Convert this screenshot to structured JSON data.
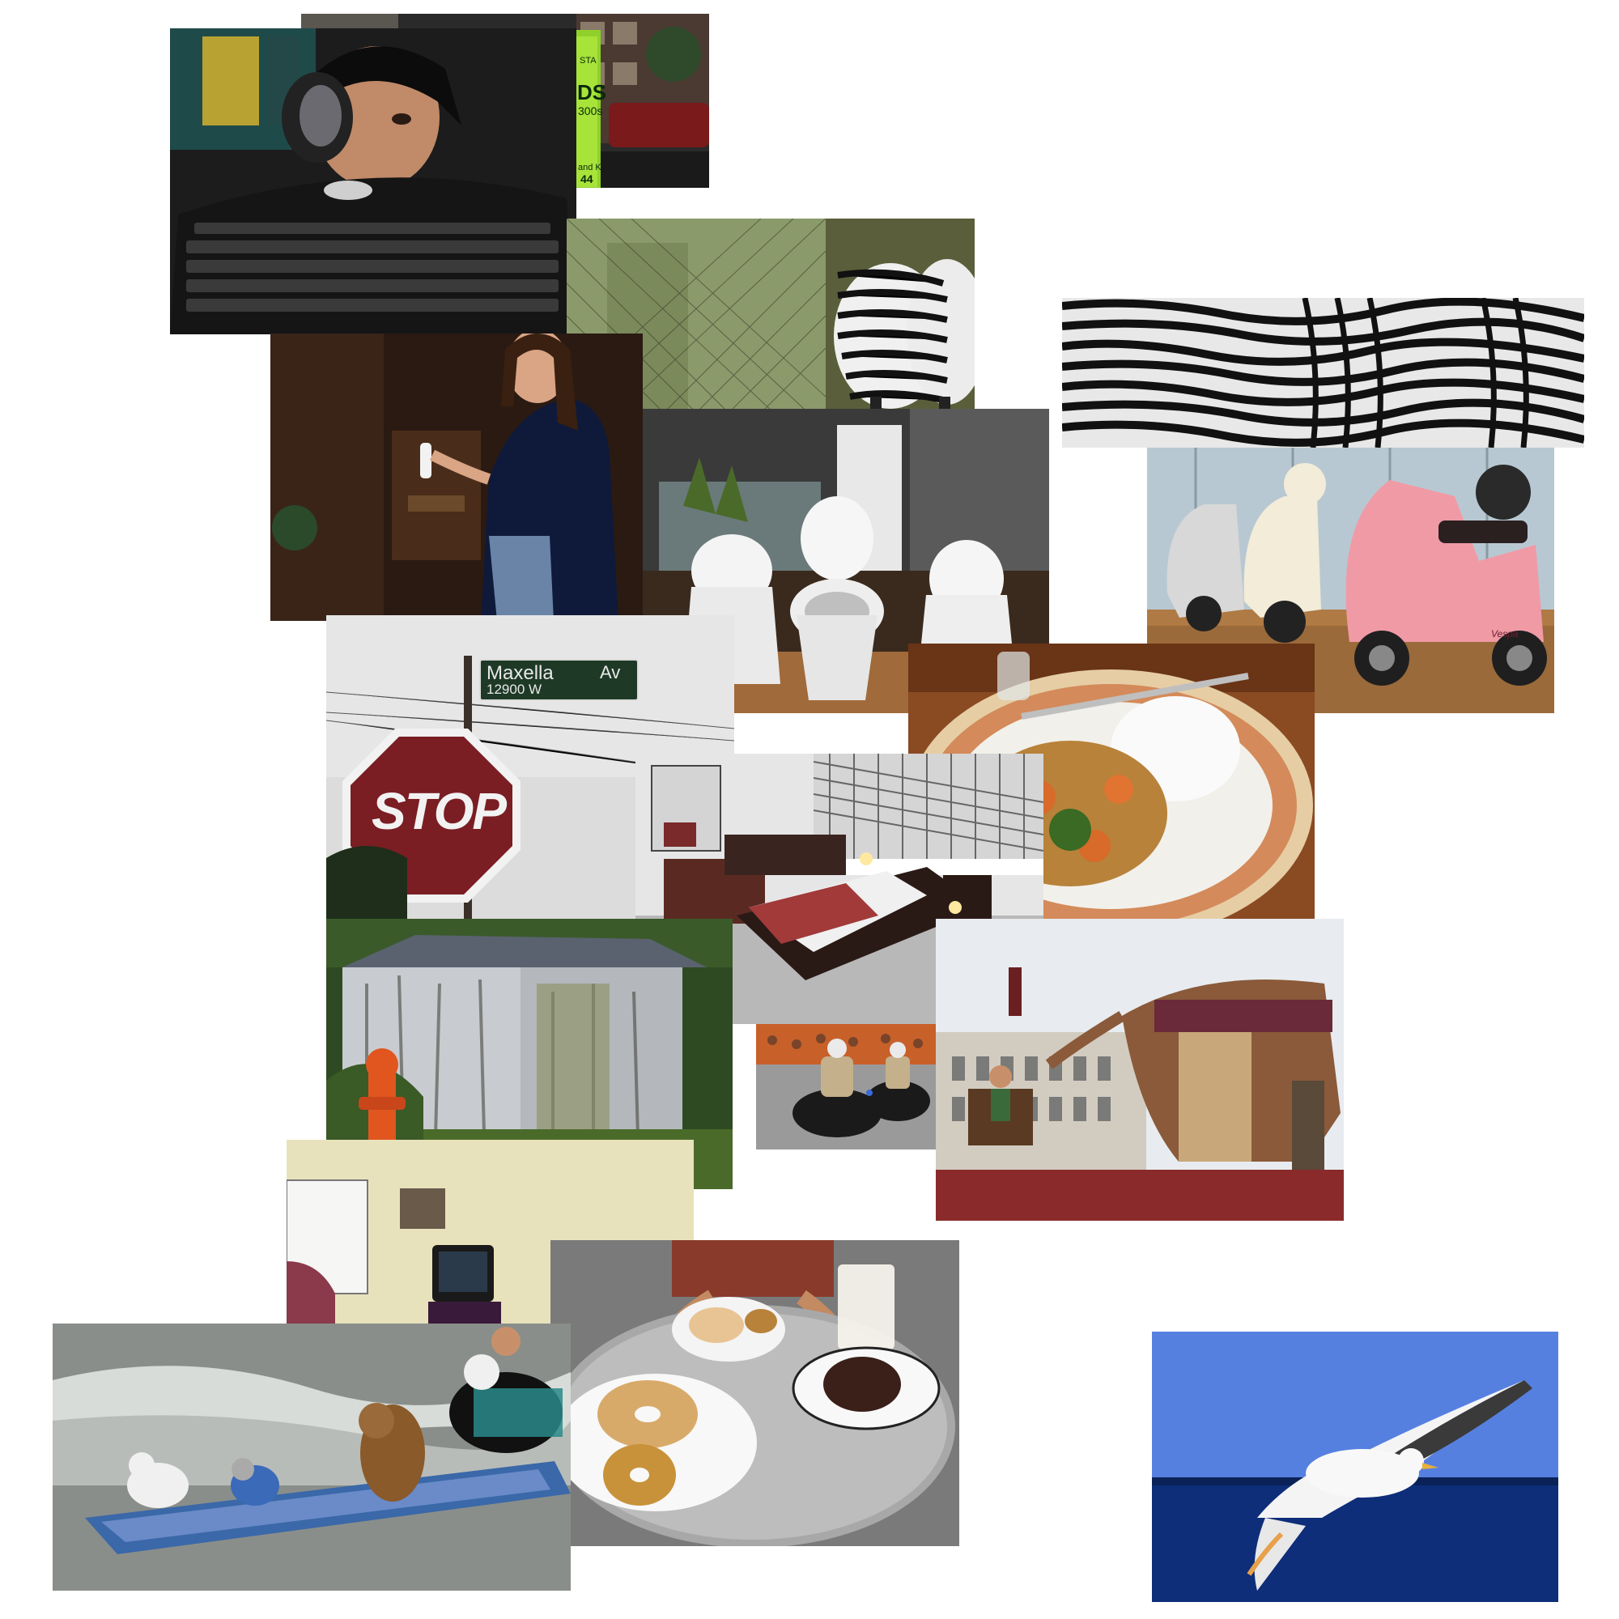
{
  "collage": {
    "photos": [
      {
        "name": "street-storefront-photo",
        "sign_text": [
          "STA",
          "DS",
          "300s",
          "and K",
          "44"
        ]
      },
      {
        "name": "man-with-keyboard-photo"
      },
      {
        "name": "zebras-at-fence-photo"
      },
      {
        "name": "zebra-herd-photo"
      },
      {
        "name": "girl-with-controller-photo"
      },
      {
        "name": "toilets-showroom-photo"
      },
      {
        "name": "scooters-showroom-photo",
        "brand": "Vespa"
      },
      {
        "name": "street-signs-photo",
        "street_sign_name": "Maxella",
        "street_sign_suffix": "Av",
        "street_sign_number": "12900 W",
        "stop_sign": "STOP"
      },
      {
        "name": "food-plate-photo"
      },
      {
        "name": "bedroom-photo"
      },
      {
        "name": "shed-and-hydrant-photo"
      },
      {
        "name": "police-motorcycles-photo"
      },
      {
        "name": "giant-elephant-parade-photo"
      },
      {
        "name": "room-with-tv-photo"
      },
      {
        "name": "donuts-table-photo"
      },
      {
        "name": "surfing-dogs-photo"
      },
      {
        "name": "seagull-photo"
      }
    ]
  }
}
